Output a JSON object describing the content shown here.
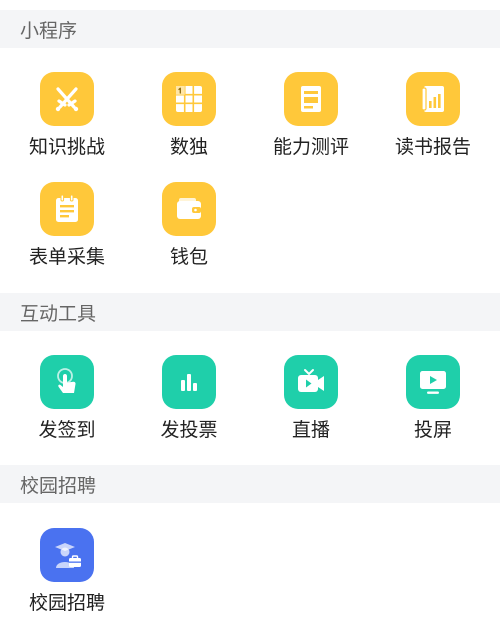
{
  "colors": {
    "section_bg": "#f4f5f7",
    "section_text": "#666666",
    "label_text": "#222222",
    "yellow": "#ffc83a",
    "teal": "#1fcfaa",
    "blue": "#4a72f0"
  },
  "sections": [
    {
      "title": "小程序",
      "items": [
        {
          "label": "知识挑战",
          "icon": "crossed-swords-icon"
        },
        {
          "label": "数独",
          "icon": "sudoku-grid-icon"
        },
        {
          "label": "能力测评",
          "icon": "assessment-doc-icon"
        },
        {
          "label": "读书报告",
          "icon": "book-report-icon"
        },
        {
          "label": "表单采集",
          "icon": "form-notepad-icon"
        },
        {
          "label": "钱包",
          "icon": "wallet-icon"
        }
      ]
    },
    {
      "title": "互动工具",
      "items": [
        {
          "label": "发签到",
          "icon": "tap-finger-icon"
        },
        {
          "label": "发投票",
          "icon": "bar-chart-icon"
        },
        {
          "label": "直播",
          "icon": "video-camera-icon"
        },
        {
          "label": "投屏",
          "icon": "screen-cast-icon"
        }
      ]
    },
    {
      "title": "校园招聘",
      "items": [
        {
          "label": "校园招聘",
          "icon": "graduate-briefcase-icon"
        }
      ]
    }
  ]
}
